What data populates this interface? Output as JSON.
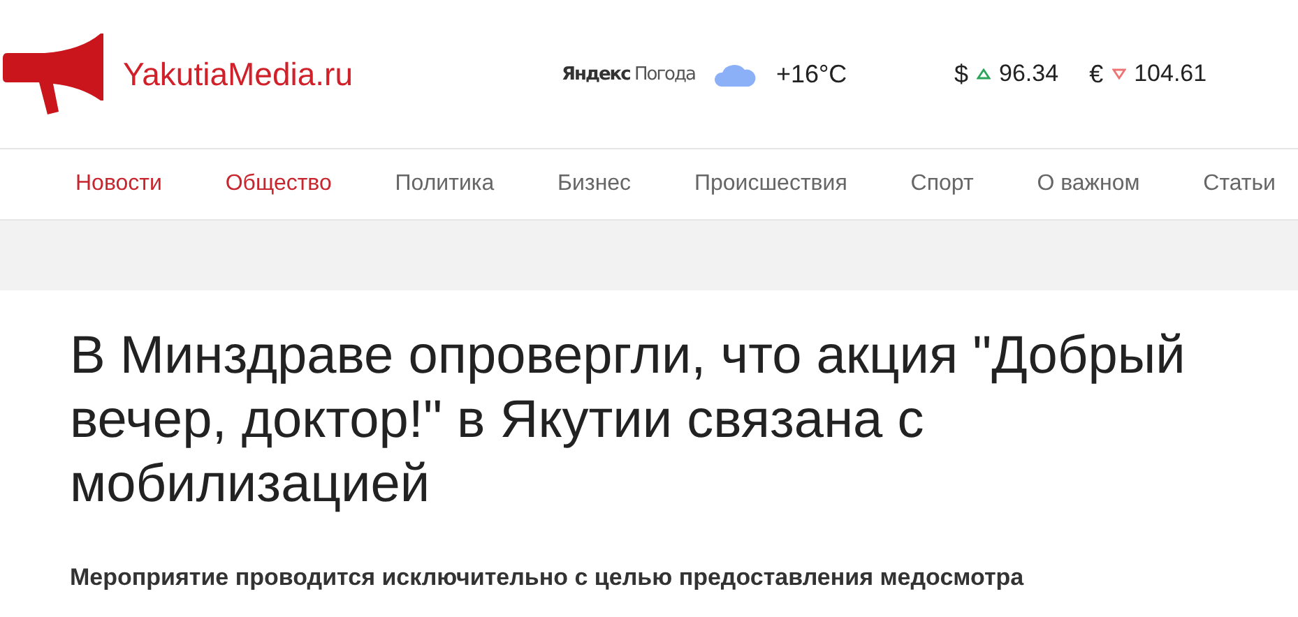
{
  "header": {
    "logo_text": "YakutiaMedia.ru",
    "weather": {
      "brand": "Яндекс",
      "service": "Погода",
      "temperature": "+16°C"
    },
    "currencies": [
      {
        "symbol": "$",
        "rising": true,
        "rate": "96.34"
      },
      {
        "symbol": "€",
        "rising": false,
        "rate": "104.61"
      }
    ]
  },
  "nav": [
    {
      "label": "Новости",
      "selected": true
    },
    {
      "label": "Общество",
      "selected": true
    },
    {
      "label": "Политика",
      "selected": false
    },
    {
      "label": "Бизнес",
      "selected": false
    },
    {
      "label": "Происшествия",
      "selected": false
    },
    {
      "label": "Спорт",
      "selected": false
    },
    {
      "label": "О важном",
      "selected": false
    },
    {
      "label": "Статьи",
      "selected": false
    }
  ],
  "article": {
    "title": "В Минздраве опровергли, что акция \"Добрый вечер, доктор!\" в Якутии связана с мобилизацией",
    "lead": "Мероприятие проводится исключительно с целью предоставления медосмотра"
  }
}
